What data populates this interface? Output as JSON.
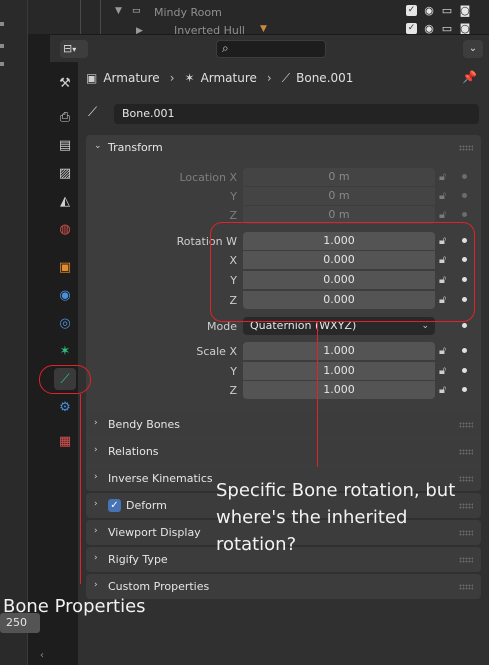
{
  "outliner": {
    "row1_label": "Mindy Room",
    "row2_label": "Inverted Hull"
  },
  "header": {
    "editor_type_icon": "properties-editor-icon",
    "search_placeholder": "",
    "options_icon": "chevron-down-icon"
  },
  "breadcrumb": {
    "object": "Armature",
    "data": "Armature",
    "bone": "Bone.001"
  },
  "bone_name": "Bone.001",
  "panels": {
    "transform": {
      "title": "Transform",
      "location_x_label": "Location X",
      "location_x": "0 m",
      "location_y_label": "Y",
      "location_y": "0 m",
      "location_z_label": "Z",
      "location_z": "0 m",
      "rotation_w_label": "Rotation W",
      "rotation_w": "1.000",
      "rotation_x_label": "X",
      "rotation_x": "0.000",
      "rotation_y_label": "Y",
      "rotation_y": "0.000",
      "rotation_z_label": "Z",
      "rotation_z": "0.000",
      "mode_label": "Mode",
      "mode_value": "Quaternion (WXYZ)",
      "scale_x_label": "Scale X",
      "scale_x": "1.000",
      "scale_y_label": "Y",
      "scale_y": "1.000",
      "scale_z_label": "Z",
      "scale_z": "1.000"
    },
    "bendy_bones": "Bendy Bones",
    "relations": "Relations",
    "inverse_kinematics": "Inverse Kinematics",
    "deform": "Deform",
    "viewport_display": "Viewport Display",
    "rigify_type": "Rigify Type",
    "custom_properties": "Custom Properties"
  },
  "left": {
    "frame_value": "250"
  },
  "annotations": {
    "note": "Specific Bone rotation, but where's the inherited rotation?",
    "caption": "Bone Properties",
    "color": "#e0222a"
  }
}
